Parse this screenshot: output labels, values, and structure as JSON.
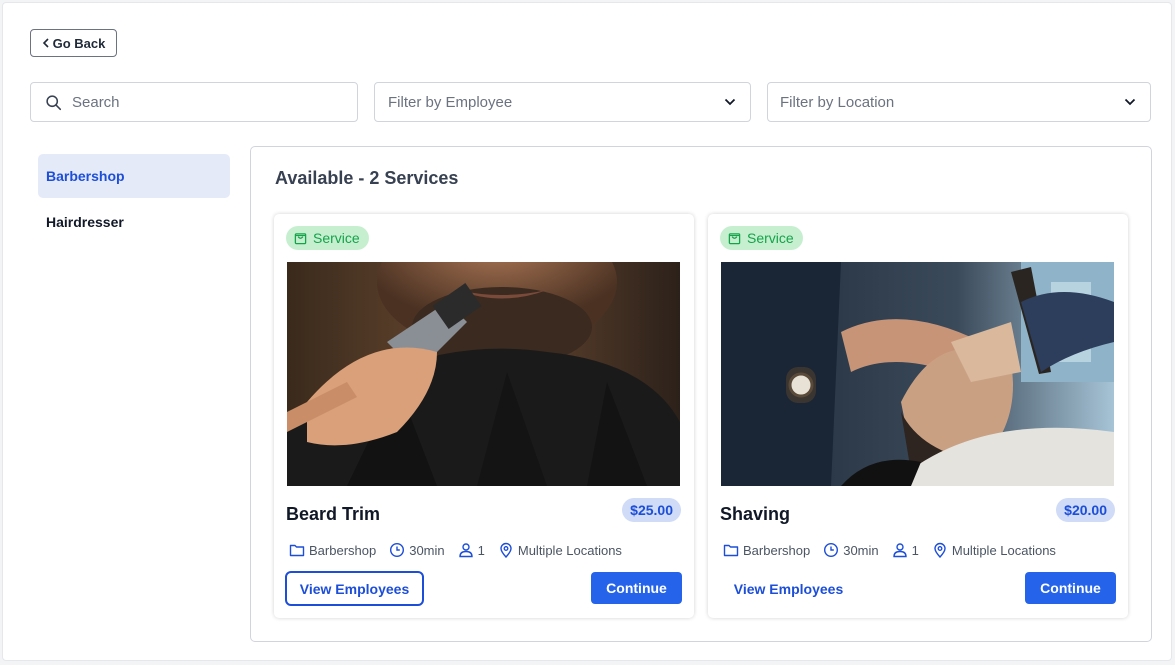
{
  "nav": {
    "go_back_label": "Go Back"
  },
  "filters": {
    "search_placeholder": "Search",
    "employee_placeholder": "Filter by Employee",
    "location_placeholder": "Filter by Location"
  },
  "sidebar": {
    "items": [
      {
        "label": "Barbershop",
        "active": true
      },
      {
        "label": "Hairdresser",
        "active": false
      }
    ]
  },
  "main": {
    "title": "Available - 2 Services",
    "services": [
      {
        "badge": "Service",
        "name": "Beard Trim",
        "price": "$25.00",
        "category": "Barbershop",
        "duration": "30min",
        "capacity": "1",
        "location": "Multiple Locations",
        "view_employees_label": "View Employees",
        "continue_label": "Continue",
        "image": "beard-trim-photo"
      },
      {
        "badge": "Service",
        "name": "Shaving",
        "price": "$20.00",
        "category": "Barbershop",
        "duration": "30min",
        "capacity": "1",
        "location": "Multiple Locations",
        "view_employees_label": "View Employees",
        "continue_label": "Continue",
        "image": "shaving-photo"
      }
    ]
  },
  "colors": {
    "accent": "#2563eb",
    "accent_dark": "#1d4ed8",
    "badge_bg": "#c6efd0",
    "badge_text": "#15a34a",
    "price_bg": "#cfdbf7",
    "sidebar_active_bg": "#e5eaf9"
  }
}
